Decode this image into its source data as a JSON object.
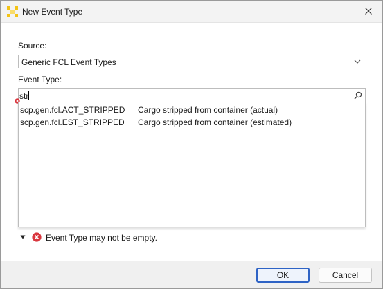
{
  "window": {
    "title": "New Event Type",
    "icon": "app-logo-icon",
    "close_icon": "close-icon"
  },
  "form": {
    "source_label": "Source:",
    "source_value": "Generic FCL Event Types",
    "event_type_label": "Event Type:",
    "event_type_value": "str"
  },
  "suggestions": [
    {
      "code": "scp.gen.fcl.ACT_STRIPPED",
      "description": "Cargo stripped from container (actual)"
    },
    {
      "code": "scp.gen.fcl.EST_STRIPPED",
      "description": "Cargo stripped from container (estimated)"
    }
  ],
  "validation": {
    "message": "Event Type may not be empty.",
    "icon": "error-icon",
    "color": "#d9363e"
  },
  "buttons": {
    "ok": "OK",
    "cancel": "Cancel"
  },
  "colors": {
    "accent": "#2e63c5",
    "logo": "#f3c316"
  }
}
